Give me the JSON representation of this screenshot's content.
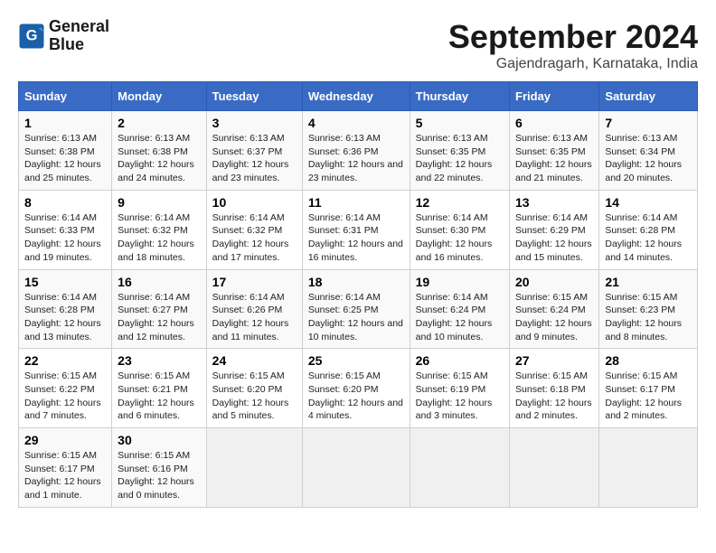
{
  "logo": {
    "line1": "General",
    "line2": "Blue"
  },
  "title": "September 2024",
  "subtitle": "Gajendragarh, Karnataka, India",
  "days_of_week": [
    "Sunday",
    "Monday",
    "Tuesday",
    "Wednesday",
    "Thursday",
    "Friday",
    "Saturday"
  ],
  "weeks": [
    [
      {
        "day": "1",
        "sunrise": "6:13 AM",
        "sunset": "6:38 PM",
        "daylight": "12 hours and 25 minutes."
      },
      {
        "day": "2",
        "sunrise": "6:13 AM",
        "sunset": "6:38 PM",
        "daylight": "12 hours and 24 minutes."
      },
      {
        "day": "3",
        "sunrise": "6:13 AM",
        "sunset": "6:37 PM",
        "daylight": "12 hours and 23 minutes."
      },
      {
        "day": "4",
        "sunrise": "6:13 AM",
        "sunset": "6:36 PM",
        "daylight": "12 hours and 23 minutes."
      },
      {
        "day": "5",
        "sunrise": "6:13 AM",
        "sunset": "6:35 PM",
        "daylight": "12 hours and 22 minutes."
      },
      {
        "day": "6",
        "sunrise": "6:13 AM",
        "sunset": "6:35 PM",
        "daylight": "12 hours and 21 minutes."
      },
      {
        "day": "7",
        "sunrise": "6:13 AM",
        "sunset": "6:34 PM",
        "daylight": "12 hours and 20 minutes."
      }
    ],
    [
      {
        "day": "8",
        "sunrise": "6:14 AM",
        "sunset": "6:33 PM",
        "daylight": "12 hours and 19 minutes."
      },
      {
        "day": "9",
        "sunrise": "6:14 AM",
        "sunset": "6:32 PM",
        "daylight": "12 hours and 18 minutes."
      },
      {
        "day": "10",
        "sunrise": "6:14 AM",
        "sunset": "6:32 PM",
        "daylight": "12 hours and 17 minutes."
      },
      {
        "day": "11",
        "sunrise": "6:14 AM",
        "sunset": "6:31 PM",
        "daylight": "12 hours and 16 minutes."
      },
      {
        "day": "12",
        "sunrise": "6:14 AM",
        "sunset": "6:30 PM",
        "daylight": "12 hours and 16 minutes."
      },
      {
        "day": "13",
        "sunrise": "6:14 AM",
        "sunset": "6:29 PM",
        "daylight": "12 hours and 15 minutes."
      },
      {
        "day": "14",
        "sunrise": "6:14 AM",
        "sunset": "6:28 PM",
        "daylight": "12 hours and 14 minutes."
      }
    ],
    [
      {
        "day": "15",
        "sunrise": "6:14 AM",
        "sunset": "6:28 PM",
        "daylight": "12 hours and 13 minutes."
      },
      {
        "day": "16",
        "sunrise": "6:14 AM",
        "sunset": "6:27 PM",
        "daylight": "12 hours and 12 minutes."
      },
      {
        "day": "17",
        "sunrise": "6:14 AM",
        "sunset": "6:26 PM",
        "daylight": "12 hours and 11 minutes."
      },
      {
        "day": "18",
        "sunrise": "6:14 AM",
        "sunset": "6:25 PM",
        "daylight": "12 hours and 10 minutes."
      },
      {
        "day": "19",
        "sunrise": "6:14 AM",
        "sunset": "6:24 PM",
        "daylight": "12 hours and 10 minutes."
      },
      {
        "day": "20",
        "sunrise": "6:15 AM",
        "sunset": "6:24 PM",
        "daylight": "12 hours and 9 minutes."
      },
      {
        "day": "21",
        "sunrise": "6:15 AM",
        "sunset": "6:23 PM",
        "daylight": "12 hours and 8 minutes."
      }
    ],
    [
      {
        "day": "22",
        "sunrise": "6:15 AM",
        "sunset": "6:22 PM",
        "daylight": "12 hours and 7 minutes."
      },
      {
        "day": "23",
        "sunrise": "6:15 AM",
        "sunset": "6:21 PM",
        "daylight": "12 hours and 6 minutes."
      },
      {
        "day": "24",
        "sunrise": "6:15 AM",
        "sunset": "6:20 PM",
        "daylight": "12 hours and 5 minutes."
      },
      {
        "day": "25",
        "sunrise": "6:15 AM",
        "sunset": "6:20 PM",
        "daylight": "12 hours and 4 minutes."
      },
      {
        "day": "26",
        "sunrise": "6:15 AM",
        "sunset": "6:19 PM",
        "daylight": "12 hours and 3 minutes."
      },
      {
        "day": "27",
        "sunrise": "6:15 AM",
        "sunset": "6:18 PM",
        "daylight": "12 hours and 2 minutes."
      },
      {
        "day": "28",
        "sunrise": "6:15 AM",
        "sunset": "6:17 PM",
        "daylight": "12 hours and 2 minutes."
      }
    ],
    [
      {
        "day": "29",
        "sunrise": "6:15 AM",
        "sunset": "6:17 PM",
        "daylight": "12 hours and 1 minute."
      },
      {
        "day": "30",
        "sunrise": "6:15 AM",
        "sunset": "6:16 PM",
        "daylight": "12 hours and 0 minutes."
      },
      null,
      null,
      null,
      null,
      null
    ]
  ]
}
